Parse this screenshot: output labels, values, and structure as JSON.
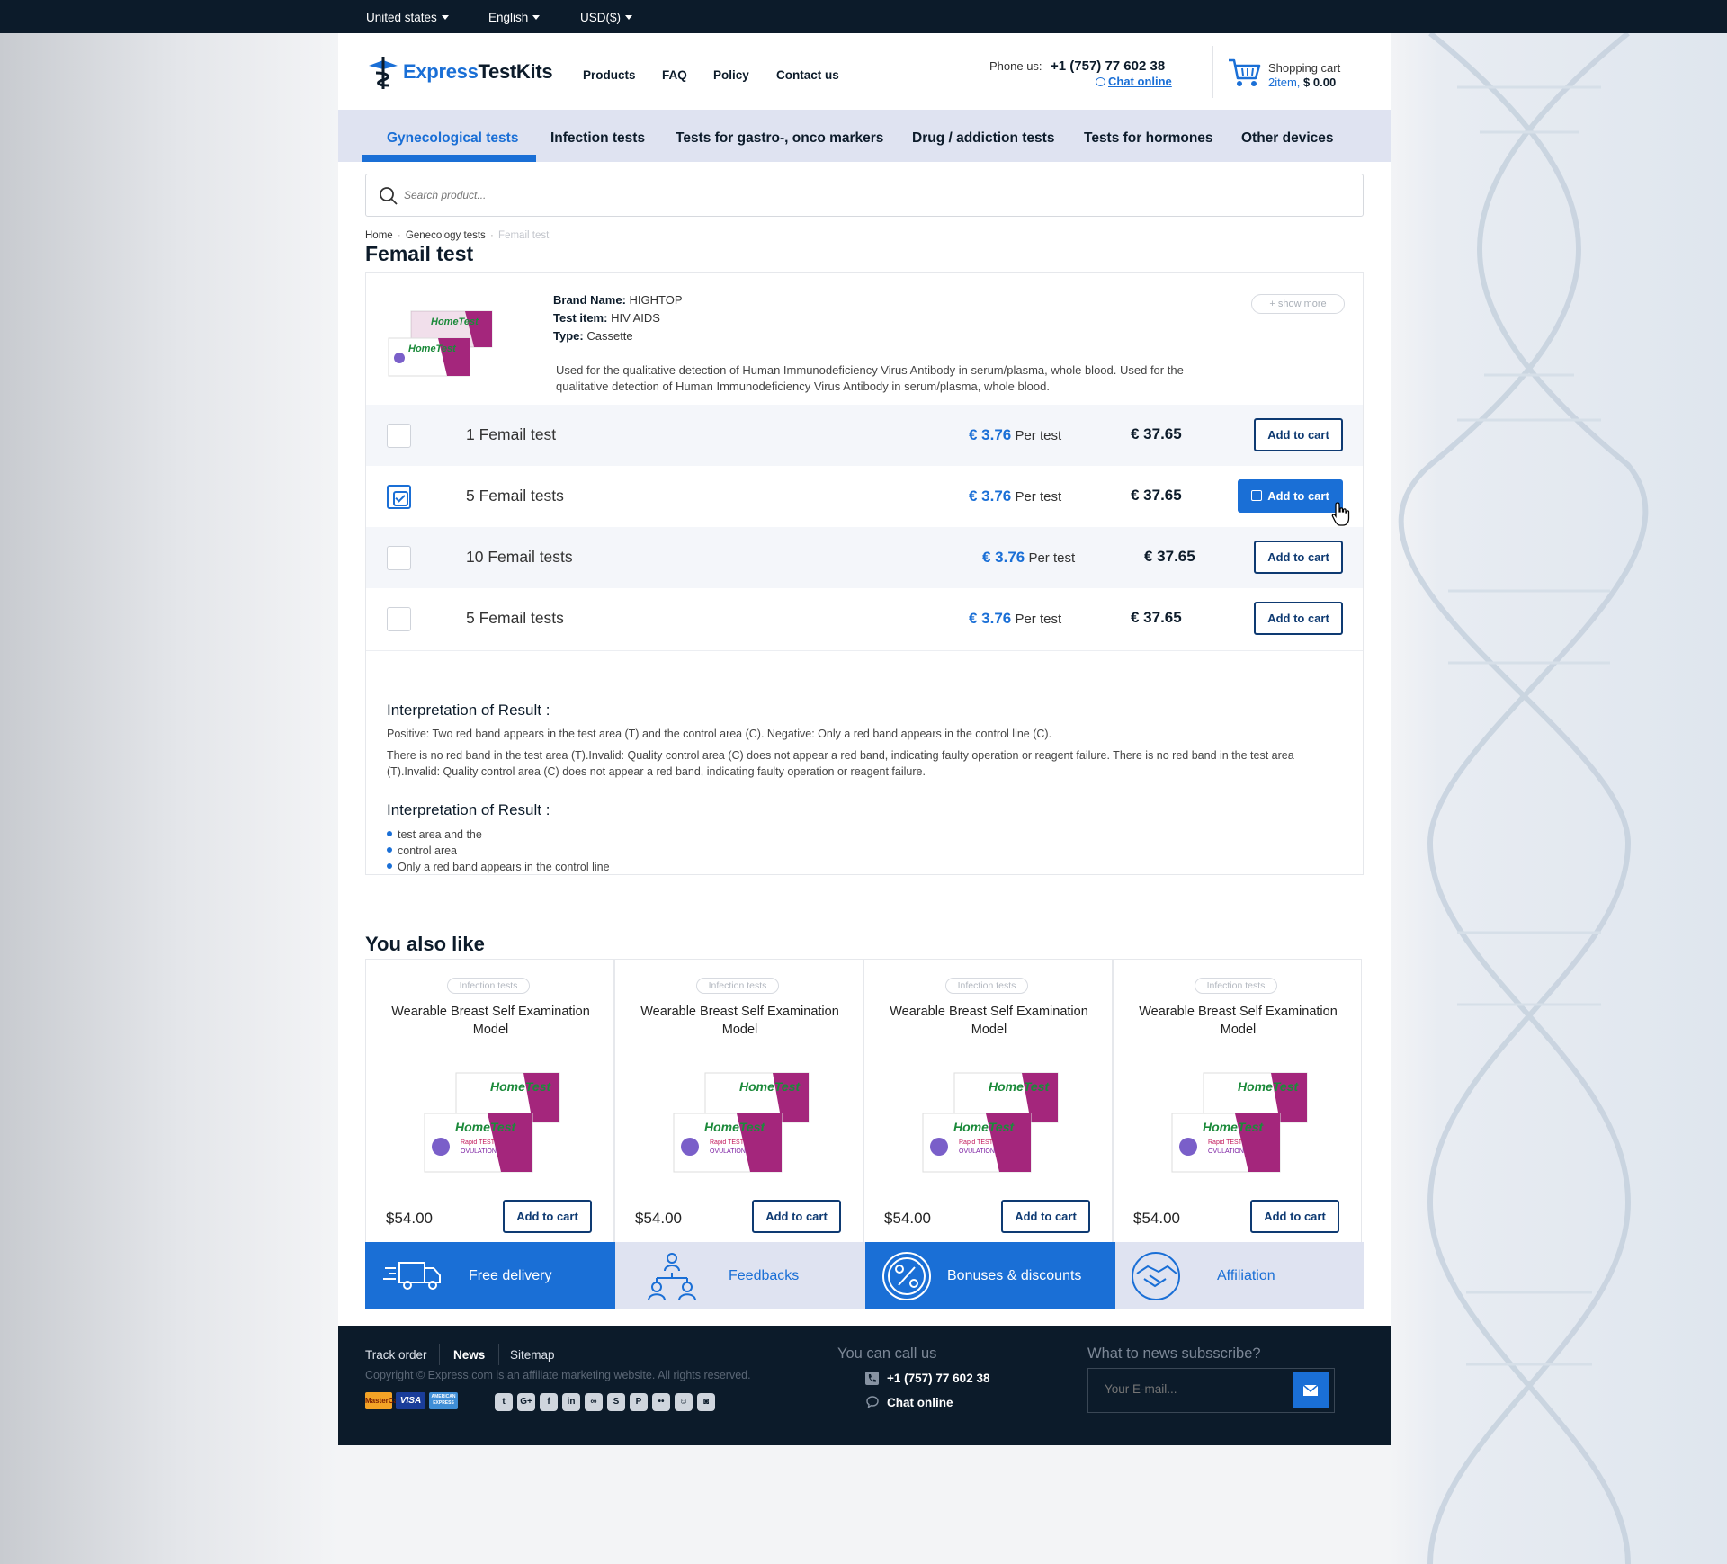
{
  "topbar": {
    "country": "United states",
    "language": "English",
    "currency": "USD($)"
  },
  "header": {
    "logo": {
      "part1": "Express",
      "part2": "TestKits"
    },
    "nav": [
      "Products",
      "FAQ",
      "Policy",
      "Contact us"
    ],
    "phone_label": "Phone us:",
    "phone_number": "+1 (757) 77 602 38",
    "chat": "Chat online",
    "cart_label": "Shopping cart",
    "cart_items": "2item,",
    "cart_total": "$ 0.00"
  },
  "categories": [
    "Gynecological tests",
    "Infection tests",
    "Tests for gastro-, onco markers",
    "Drug / addiction tests",
    "Tests for hormones",
    "Other devices"
  ],
  "search": {
    "placeholder": "Search product..."
  },
  "breadcrumb": {
    "home": "Home",
    "category": "Genecology tests",
    "current": "Femail test"
  },
  "product": {
    "title": "Femail test",
    "brand_label": "Brand Name:",
    "brand": "HIGHTOP",
    "item_label": "Test item:",
    "item": "HIV AIDS",
    "type_label": "Type:",
    "type": "Cassette",
    "description": "Used for the qualitative detection of Human Immunodeficiency Virus Antibody in serum/plasma, whole blood. Used for the qualitative detection of Human Immunodeficiency Virus Antibody in serum/plasma, whole blood.",
    "show_more": "+ show more",
    "options": [
      {
        "name": "1 Femail test",
        "price": "€ 3.76",
        "per": "Per test",
        "total": "€ 37.65",
        "btn": "Add to cart",
        "checked": false
      },
      {
        "name": "5 Femail tests",
        "price": "€ 3.76",
        "per": "Per test",
        "total": "€ 37.65",
        "btn": "Add to cart",
        "checked": true
      },
      {
        "name": "10 Femail tests",
        "price": "€ 3.76",
        "per": "Per test",
        "total": "€ 37.65",
        "btn": "Add to cart",
        "checked": false
      },
      {
        "name": "5 Femail tests",
        "price": "€ 3.76",
        "per": "Per test",
        "total": "€ 37.65",
        "btn": "Add to cart",
        "checked": false
      }
    ],
    "interp1_title": "Interpretation of Result :",
    "interp1_p1": "Positive: Two red band appears in the test area (T) and the control area (C). Negative: Only a red band appears in the control line (C).",
    "interp1_p2": "There is no red band in the test area (T).Invalid: Quality control area (C) does not appear a red band, indicating faulty operation or reagent failure. There is no red band in the test area (T).Invalid: Quality control area (C) does not appear a red band, indicating faulty operation or reagent failure.",
    "interp2_title": "Interpretation of Result :",
    "interp2_items": [
      "test area and the",
      "control area",
      "Only a red band appears in the control line"
    ]
  },
  "also_like": {
    "title": "You also like",
    "items": [
      {
        "badge": "Infection tests",
        "name": "Wearable Breast Self Examination Model",
        "price": "$54.00",
        "btn": "Add to cart"
      },
      {
        "badge": "Infection tests",
        "name": "Wearable Breast Self Examination Model",
        "price": "$54.00",
        "btn": "Add to cart"
      },
      {
        "badge": "Infection tests",
        "name": "Wearable Breast Self Examination Model",
        "price": "$54.00",
        "btn": "Add to cart"
      },
      {
        "badge": "Infection tests",
        "name": "Wearable Breast Self Examination Model",
        "price": "$54.00",
        "btn": "Add to cart"
      }
    ]
  },
  "benefits": [
    "Free delivery",
    "Feedbacks",
    "Bonuses & discounts",
    "Affiliation"
  ],
  "product_image": {
    "brand": "HomeTest",
    "line1": "Rapid TEST",
    "line2": "OVULATION"
  },
  "footer": {
    "links": [
      "Track order",
      "News",
      "Sitemap"
    ],
    "copyright": "Copyright © Express.com is an affiliate marketing website. All rights reserved.",
    "payments": [
      "MasterCard",
      "VISA",
      "AMERICAN EXPRESS"
    ],
    "social_icons": [
      "twitter-icon",
      "google-plus-icon",
      "facebook-icon",
      "linkedin-icon",
      "link-icon",
      "skype-icon",
      "pinterest-icon",
      "flickr-icon",
      "social-icon",
      "instagram-icon"
    ],
    "call_title": "You can call us",
    "call_number": "+1 (757) 77 602 38",
    "call_chat": "Chat online",
    "news_title": "What to news subsscribe?",
    "news_placeholder": "Your E-mail..."
  },
  "colors": {
    "accent": "#1a6fd6",
    "dark": "#0c1b2a",
    "light_band": "#dfe3f1"
  }
}
